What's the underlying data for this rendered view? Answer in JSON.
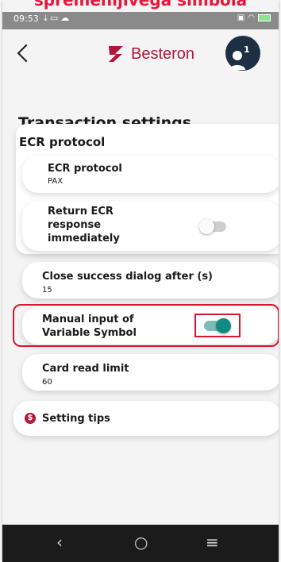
{
  "caption": "spremenljivega simbola",
  "status_bar": {
    "time": "09:53",
    "left_icons": [
      "download-icon",
      "message-icon",
      "cloud-icon",
      "cloud-icon"
    ],
    "right_icons": [
      "cast-icon",
      "wifi-icon",
      "battery-icon"
    ]
  },
  "header": {
    "back_icon": "back-arrow-icon",
    "brand": "Besteron",
    "brand_color": "#b3163a",
    "avatar_badge": "1"
  },
  "page_title": "Transaction settings",
  "ecr_group": {
    "title": "ECR protocol",
    "protocol_row": {
      "label": "ECR protocol",
      "value": "PAX"
    },
    "return_row": {
      "label_lines": [
        "Return ECR",
        "response",
        "immediately"
      ],
      "toggle_on": false
    }
  },
  "close_dialog_row": {
    "label": "Close success dialog after (s)",
    "value": "15"
  },
  "manual_input_row": {
    "label_lines": [
      "Manual input of",
      "Variable Symbol"
    ],
    "toggle_on": true,
    "accent": "#0f8a84"
  },
  "card_limit_row": {
    "label": "Card read limit",
    "value": "60"
  },
  "tips_row": {
    "icon_symbol": "$",
    "label": "Setting tips"
  },
  "nav_bar": {
    "back": "‹",
    "home": "○",
    "menu": "≡"
  }
}
